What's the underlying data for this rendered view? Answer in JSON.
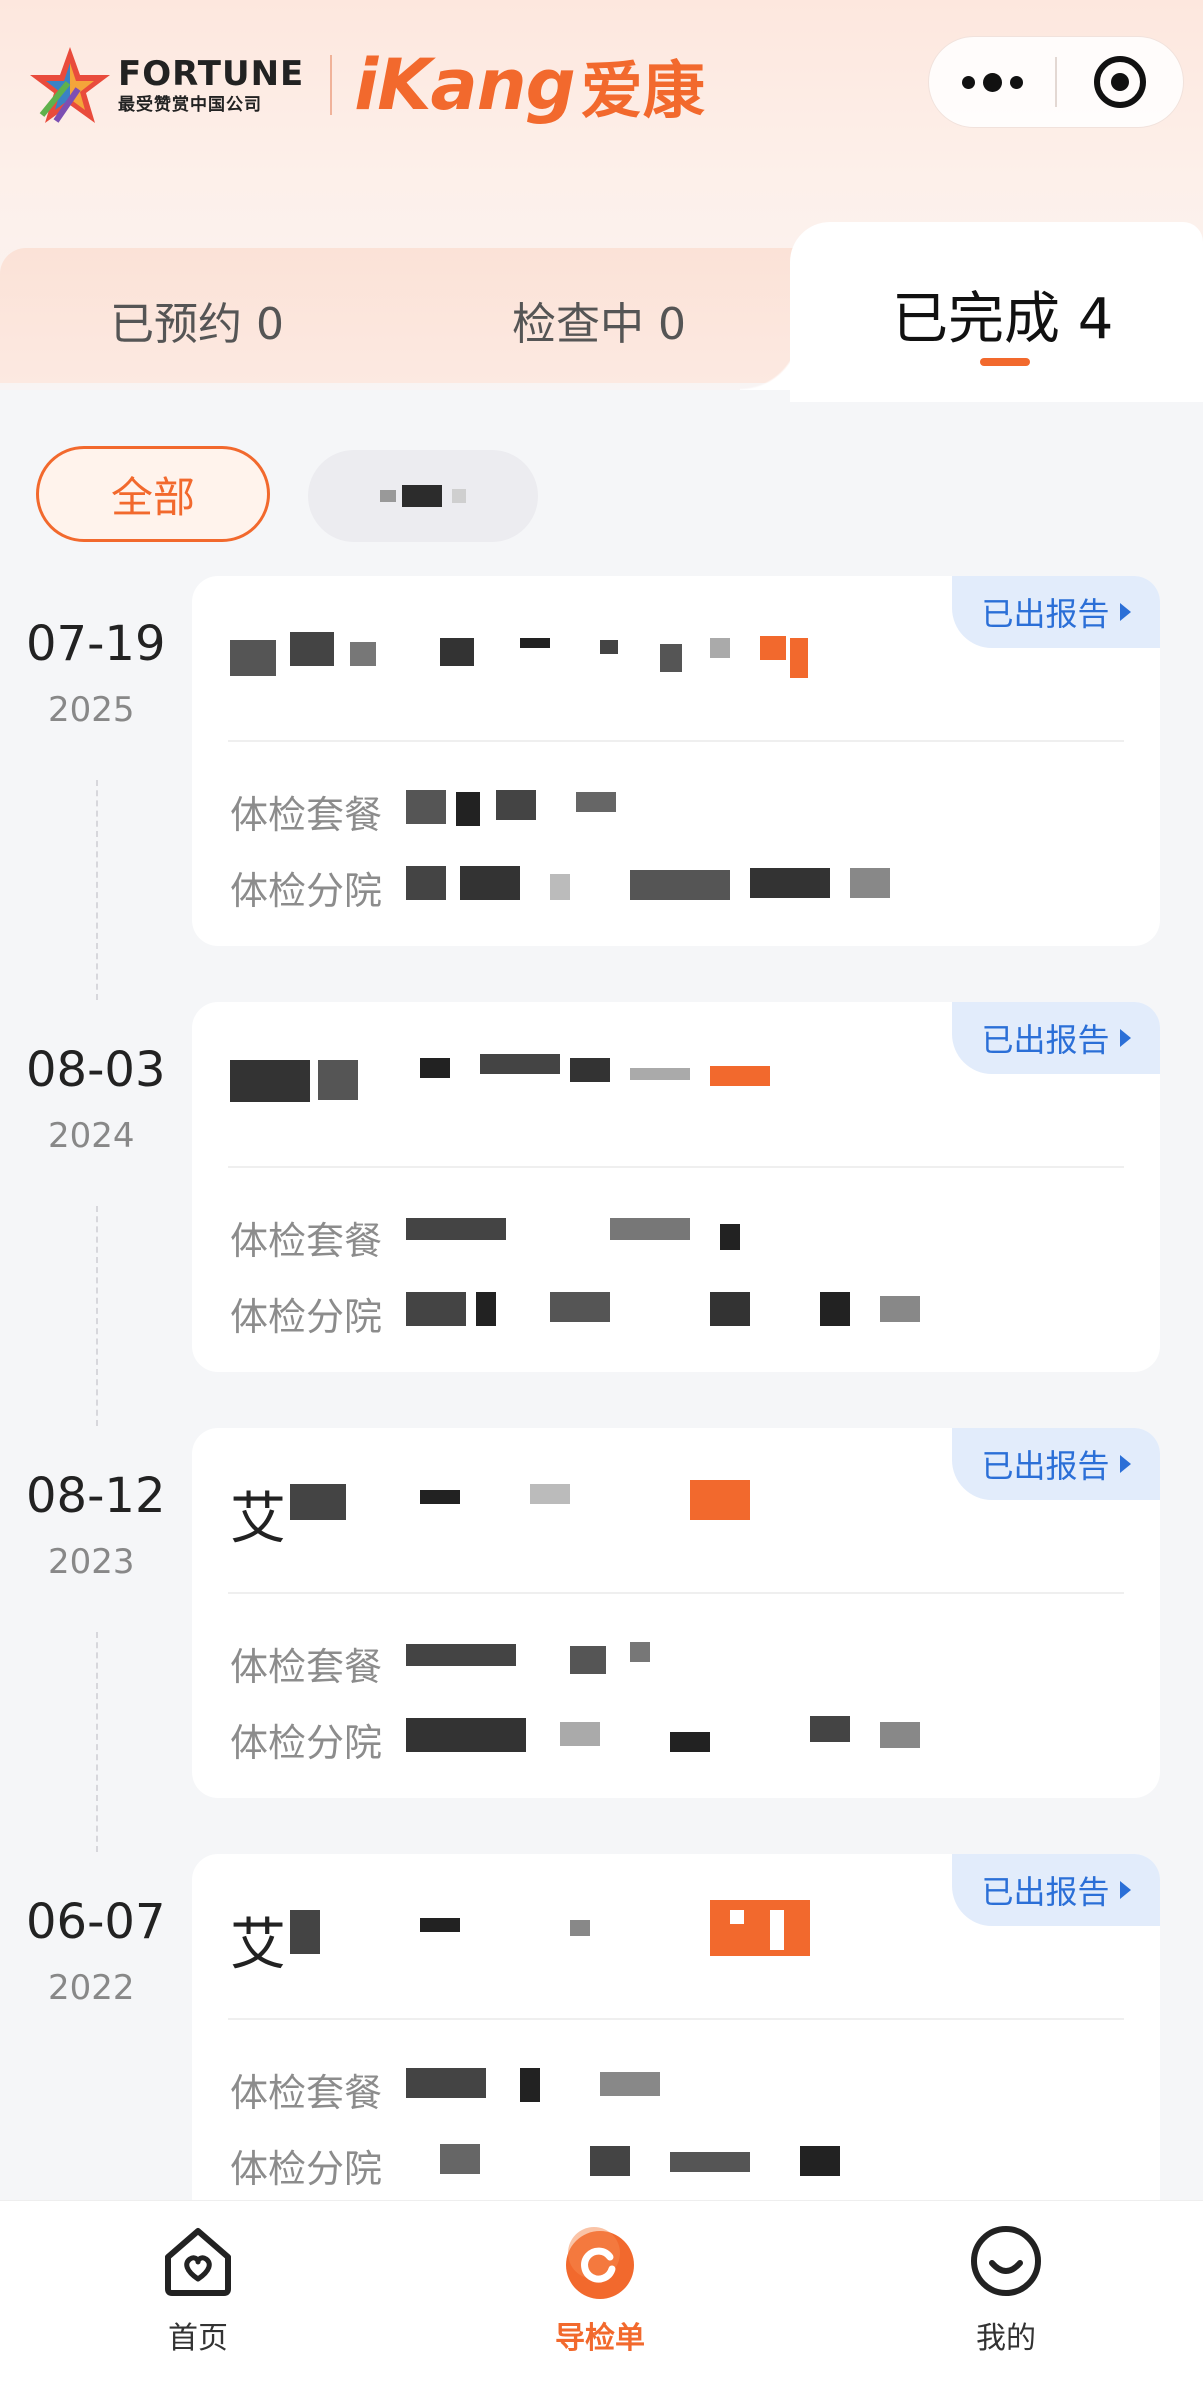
{
  "header": {
    "fortune_word": "FORTUNE",
    "fortune_sub": "最受赞赏中国公司",
    "brand_en": "iKang",
    "brand_cn": "爱康"
  },
  "capsule": {
    "more_icon": "more-dots-icon",
    "close_icon": "miniprogram-close-icon"
  },
  "tabs": [
    {
      "label": "已预约 0"
    },
    {
      "label": "检查中 0"
    },
    {
      "label": "已完成 4",
      "active": true
    }
  ],
  "filters": {
    "all_label": "全部"
  },
  "records": [
    {
      "date": "07-19",
      "year": "2025",
      "title_prefix": "艾",
      "badge": "已出报告",
      "package_label": "体检套餐",
      "branch_label": "体检分院"
    },
    {
      "date": "08-03",
      "year": "2024",
      "title_prefix": "艾",
      "badge": "已出报告",
      "package_label": "体检套餐",
      "branch_label": "体检分院"
    },
    {
      "date": "08-12",
      "year": "2023",
      "title_prefix": "艾",
      "badge": "已出报告",
      "package_label": "体检套餐",
      "branch_label": "体检分院"
    },
    {
      "date": "06-07",
      "year": "2022",
      "title_prefix": "艾",
      "badge": "已出报告",
      "package_label": "体检套餐",
      "branch_label": "体检分院"
    }
  ],
  "bottom_nav": [
    {
      "label": "首页",
      "icon": "home-heart-icon"
    },
    {
      "label": "导检单",
      "icon": "guide-sheet-icon",
      "active": true
    },
    {
      "label": "我的",
      "icon": "profile-smile-icon"
    }
  ],
  "colors": {
    "accent": "#f2692d",
    "badge_bg": "#e2ecfb",
    "badge_text": "#2b6fd7"
  }
}
